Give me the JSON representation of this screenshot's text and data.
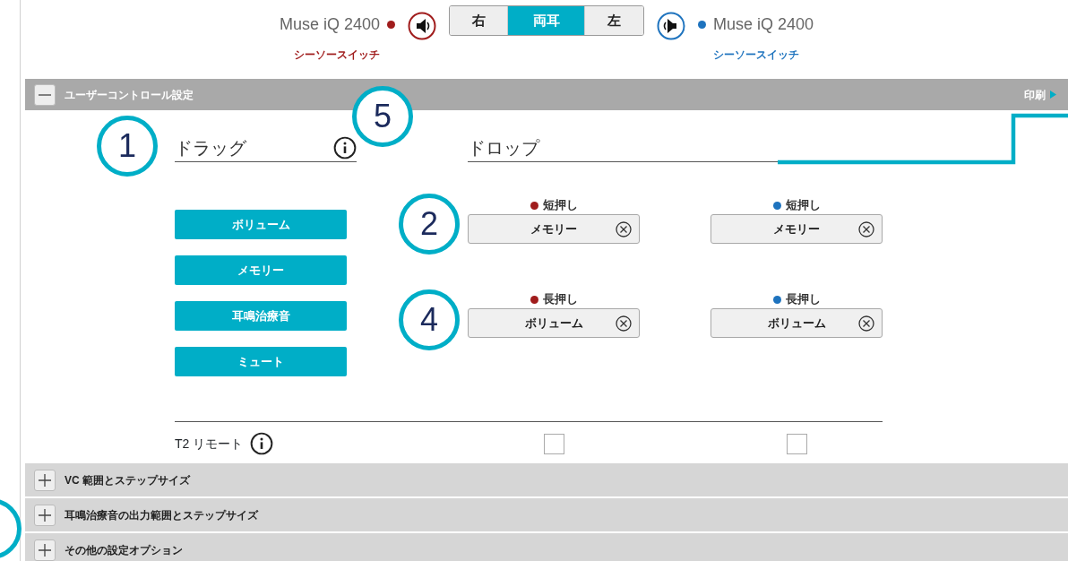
{
  "device_bar": {
    "left": {
      "model": "Muse iQ 2400",
      "color": "#a01c1c",
      "link": "シーソースイッチ"
    },
    "right": {
      "model": "Muse iQ 2400",
      "color": "#1e73be",
      "link": "シーソースイッチ"
    },
    "ear_tabs": [
      {
        "label": "右",
        "selected": false
      },
      {
        "label": "両耳",
        "selected": true
      },
      {
        "label": "左",
        "selected": false
      }
    ]
  },
  "sections": [
    {
      "title": "ユーザーコントロール設定",
      "expanded": true,
      "action": "印刷"
    },
    {
      "title": "VC 範囲とステップサイズ",
      "expanded": false
    },
    {
      "title": "耳鳴治療音の出力範囲とステップサイズ",
      "expanded": false
    },
    {
      "title": "その他の設定オプション",
      "expanded": false
    }
  ],
  "drag": {
    "heading": "ドラッグ",
    "items": [
      "ボリューム",
      "メモリー",
      "耳鳴治療音",
      "ミュート"
    ]
  },
  "drop": {
    "heading": "ドロップ",
    "rows": [
      {
        "slots": [
          {
            "label": "短押し",
            "value": "メモリー",
            "color": "#a01c1c"
          },
          {
            "label": "短押し",
            "value": "メモリー",
            "color": "#1e73be"
          }
        ]
      },
      {
        "slots": [
          {
            "label": "長押し",
            "value": "ボリューム",
            "color": "#a01c1c"
          },
          {
            "label": "長押し",
            "value": "ボリューム",
            "color": "#1e73be"
          }
        ]
      }
    ]
  },
  "t2_remote": {
    "label": "T2 リモート",
    "checks": [
      {
        "checked": false
      },
      {
        "checked": false
      }
    ]
  },
  "callouts": [
    {
      "kind": "number",
      "number": "1"
    },
    {
      "kind": "number",
      "number": "5"
    },
    {
      "kind": "number",
      "number": "2"
    },
    {
      "kind": "number",
      "number": "4"
    },
    {
      "kind": "partial"
    }
  ]
}
